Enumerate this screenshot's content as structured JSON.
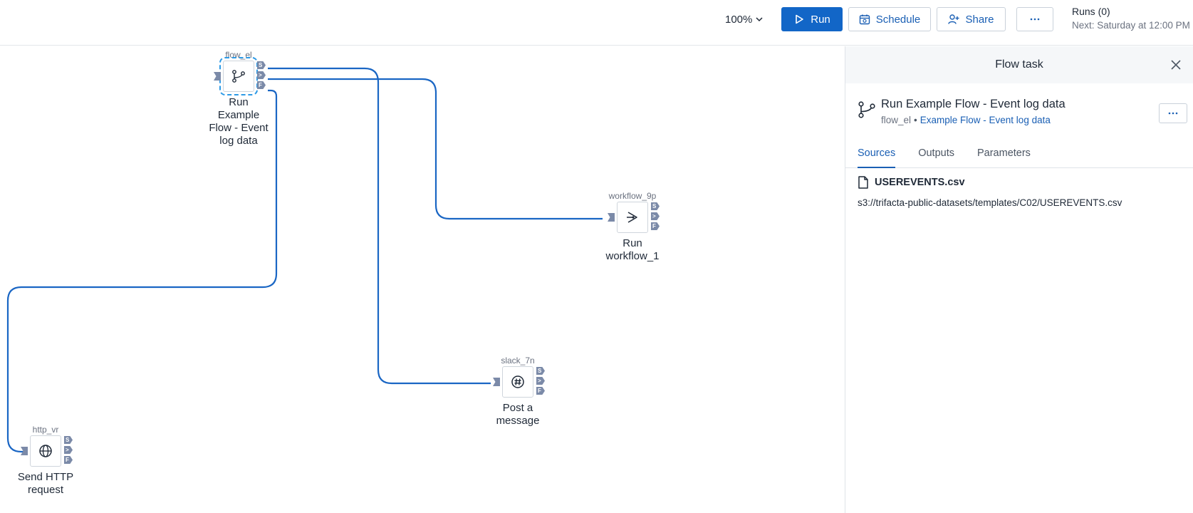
{
  "toolbar": {
    "zoom": "100%",
    "run_label": "Run",
    "schedule_label": "Schedule",
    "share_label": "Share",
    "more_label": "···",
    "runs_count": "Runs (0)",
    "next_run": "Next: Saturday at 12:00 PM"
  },
  "nodes": {
    "flow": {
      "id": "flow_el",
      "label": "Run Example Flow - Event log data",
      "icon": "flow-icon"
    },
    "workflow": {
      "id": "workflow_9p",
      "label": "Run workflow_1",
      "icon": "workflow-icon"
    },
    "slack": {
      "id": "slack_7n",
      "label": "Post a message",
      "icon": "slack-icon"
    },
    "http": {
      "id": "http_vr",
      "label": "Send HTTP request",
      "icon": "globe-icon"
    }
  },
  "ports": {
    "success": "S",
    "complete": ">",
    "failure": "F"
  },
  "panel": {
    "title": "Flow task",
    "task_title": "Run Example Flow - Event log data",
    "task_id": "flow_el",
    "task_link": "Example Flow - Event log data",
    "tabs": [
      "Sources",
      "Outputs",
      "Parameters"
    ],
    "source_name": "USEREVENTS.csv",
    "source_path": "s3://trifacta-public-datasets/templates/C02/USEREVENTS.csv"
  },
  "colors": {
    "accent": "#1266c7",
    "wire": "#1a66c4",
    "port": "#7b8aa8",
    "selection": "#2d9ae6"
  }
}
